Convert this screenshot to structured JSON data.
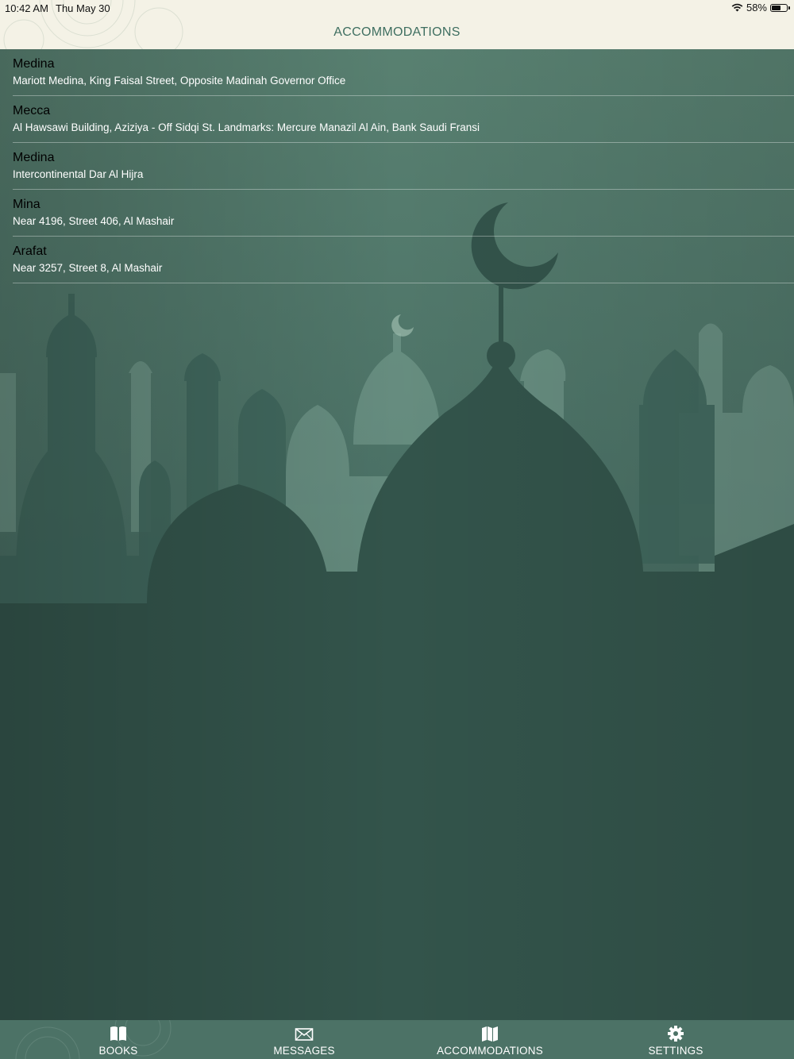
{
  "status_bar": {
    "time": "10:42 AM",
    "date": "Thu May 30",
    "battery": "58%",
    "wifi_icon": "wifi-icon",
    "battery_icon": "battery-icon"
  },
  "nav": {
    "title": "ACCOMMODATIONS"
  },
  "accommodations": [
    {
      "city": "Medina",
      "address": "Mariott Medina, King Faisal Street, Opposite Madinah Governor Office"
    },
    {
      "city": "Mecca",
      "address": "Al Hawsawi Building, Aziziya - Off Sidqi St. Landmarks: Mercure Manazil Al Ain, Bank Saudi Fransi"
    },
    {
      "city": "Medina",
      "address": "Intercontinental Dar Al Hijra"
    },
    {
      "city": "Mina",
      "address": "Near 4196, Street 406, Al Mashair"
    },
    {
      "city": "Arafat",
      "address": "Near 3257, Street 8, Al Mashair"
    }
  ],
  "tabs": [
    {
      "label": "BOOKS",
      "icon": "book-icon"
    },
    {
      "label": "MESSAGES",
      "icon": "envelope-icon"
    },
    {
      "label": "ACCOMMODATIONS",
      "icon": "map-icon"
    },
    {
      "label": "SETTINGS",
      "icon": "gear-icon"
    }
  ],
  "colors": {
    "nav_background": "#f4f2e6",
    "nav_title": "#3e6e60",
    "background_top": "#557d70",
    "background_bottom": "#2d4640",
    "tab_bar": "#4c7266"
  }
}
